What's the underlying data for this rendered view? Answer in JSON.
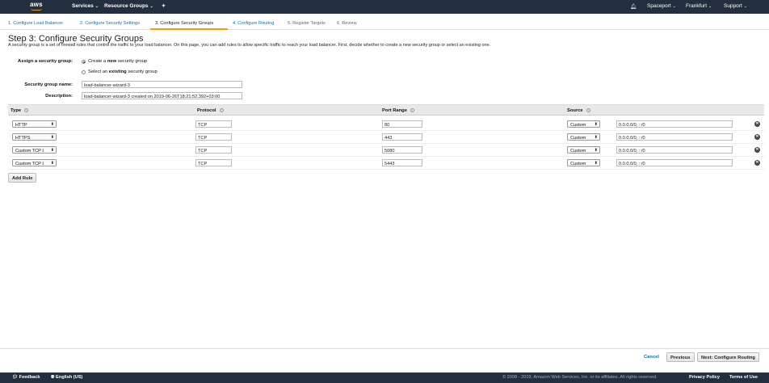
{
  "topnav": {
    "logo": "aws",
    "services": "Services",
    "resource_groups": "Resource Groups",
    "pin_icon": "pin-icon",
    "bell_icon": "bell-icon",
    "account": "Spaceport",
    "region": "Frankfurt",
    "support": "Support"
  },
  "steps": [
    {
      "label": "1. Configure Load Balancer"
    },
    {
      "label": "2. Configure Security Settings"
    },
    {
      "label": "3. Configure Security Groups"
    },
    {
      "label": "4. Configure Routing"
    },
    {
      "label": "5. Register Targets"
    },
    {
      "label": "6. Review"
    }
  ],
  "page": {
    "title": "Step 3: Configure Security Groups",
    "intro": "A security group is a set of firewall rules that control the traffic to your load balancer. On this page, you can add rules to allow specific traffic to reach your load balancer. First, decide whether to create a new security group or select an existing one."
  },
  "form": {
    "assign_label": "Assign a security group:",
    "option_create_pre": "Create a ",
    "option_create_bold": "new",
    "option_create_post": " security group",
    "option_select_pre": "Select an ",
    "option_select_bold": "existing",
    "option_select_post": " security group",
    "selected_option": "create",
    "name_label": "Security group name:",
    "name_value": "load-balancer-wizard-3",
    "desc_label": "Description:",
    "desc_value": "load-balancer-wizard-3 created on 2019-06-26T18:21:52.392+03:00"
  },
  "table": {
    "headers": {
      "type": "Type",
      "protocol": "Protocol",
      "port_range": "Port Range",
      "source": "Source"
    },
    "info_glyph": "i",
    "rows": [
      {
        "type": "HTTP",
        "protocol": "TCP",
        "port": "80",
        "source": "Custom",
        "cidr": "0.0.0.0/0, ::/0"
      },
      {
        "type": "HTTPS",
        "protocol": "TCP",
        "port": "443",
        "source": "Custom",
        "cidr": "0.0.0.0/0, ::/0"
      },
      {
        "type": "Custom TCP I",
        "protocol": "TCP",
        "port": "5080",
        "source": "Custom",
        "cidr": "0.0.0.0/0, ::/0"
      },
      {
        "type": "Custom TCP I",
        "protocol": "TCP",
        "port": "5443",
        "source": "Custom",
        "cidr": "0.0.0.0/0, ::/0"
      }
    ],
    "add_rule": "Add Rule"
  },
  "actions": {
    "cancel": "Cancel",
    "previous": "Previous",
    "next": "Next: Configure Routing"
  },
  "bottombar": {
    "feedback": "Feedback",
    "language": "English (US)",
    "copyright": "© 2008 - 2019, Amazon Web Services, Inc. or its affiliates. All rights reserved.",
    "privacy": "Privacy Policy",
    "terms": "Terms of Use"
  },
  "colors": {
    "nav_bg": "#232f3e",
    "link": "#0073bb",
    "accent": "#ff9900"
  }
}
